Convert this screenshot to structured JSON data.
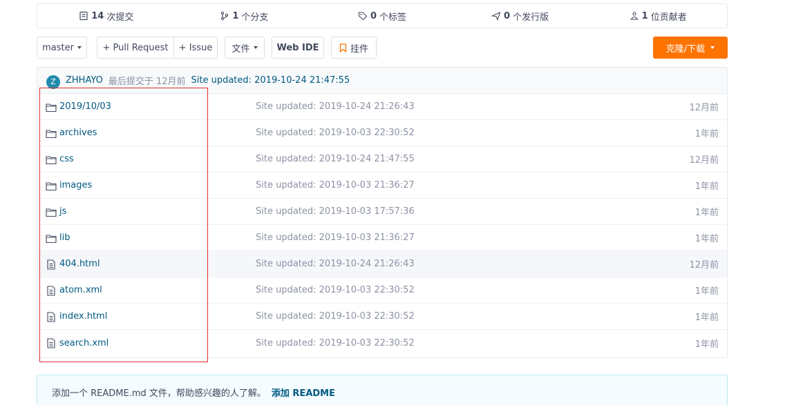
{
  "stats": {
    "commits": {
      "count": "14",
      "label": "次提交"
    },
    "branches": {
      "count": "1",
      "label": "个分支"
    },
    "tags": {
      "count": "0",
      "label": "个标签"
    },
    "releases": {
      "count": "0",
      "label": "个发行版"
    },
    "contributors": {
      "count": "1",
      "label": "位贡献者"
    }
  },
  "toolbar": {
    "branch": "master",
    "pull_request": "+ Pull Request",
    "issue": "+ Issue",
    "file_menu": "文件",
    "web_ide": "Web IDE",
    "widget": "挂件",
    "clone": "克隆/下载"
  },
  "commit": {
    "avatar_letter": "Z",
    "author": "ZHHAYO",
    "time_text": "最后提交于 12月前",
    "message": "Site updated: 2019-10-24 21:47:55"
  },
  "files": [
    {
      "name": "2019/10/03",
      "type": "folder",
      "message": "Site updated: 2019-10-24 21:26:43",
      "time": "12月前"
    },
    {
      "name": "archives",
      "type": "folder",
      "message": "Site updated: 2019-10-03 22:30:52",
      "time": "1年前"
    },
    {
      "name": "css",
      "type": "folder",
      "message": "Site updated: 2019-10-24 21:47:55",
      "time": "12月前"
    },
    {
      "name": "images",
      "type": "folder",
      "message": "Site updated: 2019-10-03 21:36:27",
      "time": "1年前"
    },
    {
      "name": "js",
      "type": "folder",
      "message": "Site updated: 2019-10-03 17:57:36",
      "time": "1年前"
    },
    {
      "name": "lib",
      "type": "folder",
      "message": "Site updated: 2019-10-03 21:36:27",
      "time": "1年前"
    },
    {
      "name": "404.html",
      "type": "file",
      "message": "Site updated: 2019-10-24 21:26:43",
      "time": "12月前"
    },
    {
      "name": "atom.xml",
      "type": "file",
      "message": "Site updated: 2019-10-03 22:30:52",
      "time": "1年前"
    },
    {
      "name": "index.html",
      "type": "file",
      "message": "Site updated: 2019-10-03 22:30:52",
      "time": "1年前"
    },
    {
      "name": "search.xml",
      "type": "file",
      "message": "Site updated: 2019-10-03 22:30:52",
      "time": "1年前"
    }
  ],
  "readme_tip": {
    "text": "添加一个 README.md 文件，帮助感兴趣的人了解。",
    "action": "添加 README"
  },
  "colors": {
    "accent": "#fe7300",
    "link": "#005980",
    "highlight_box": "#e02c2c"
  }
}
